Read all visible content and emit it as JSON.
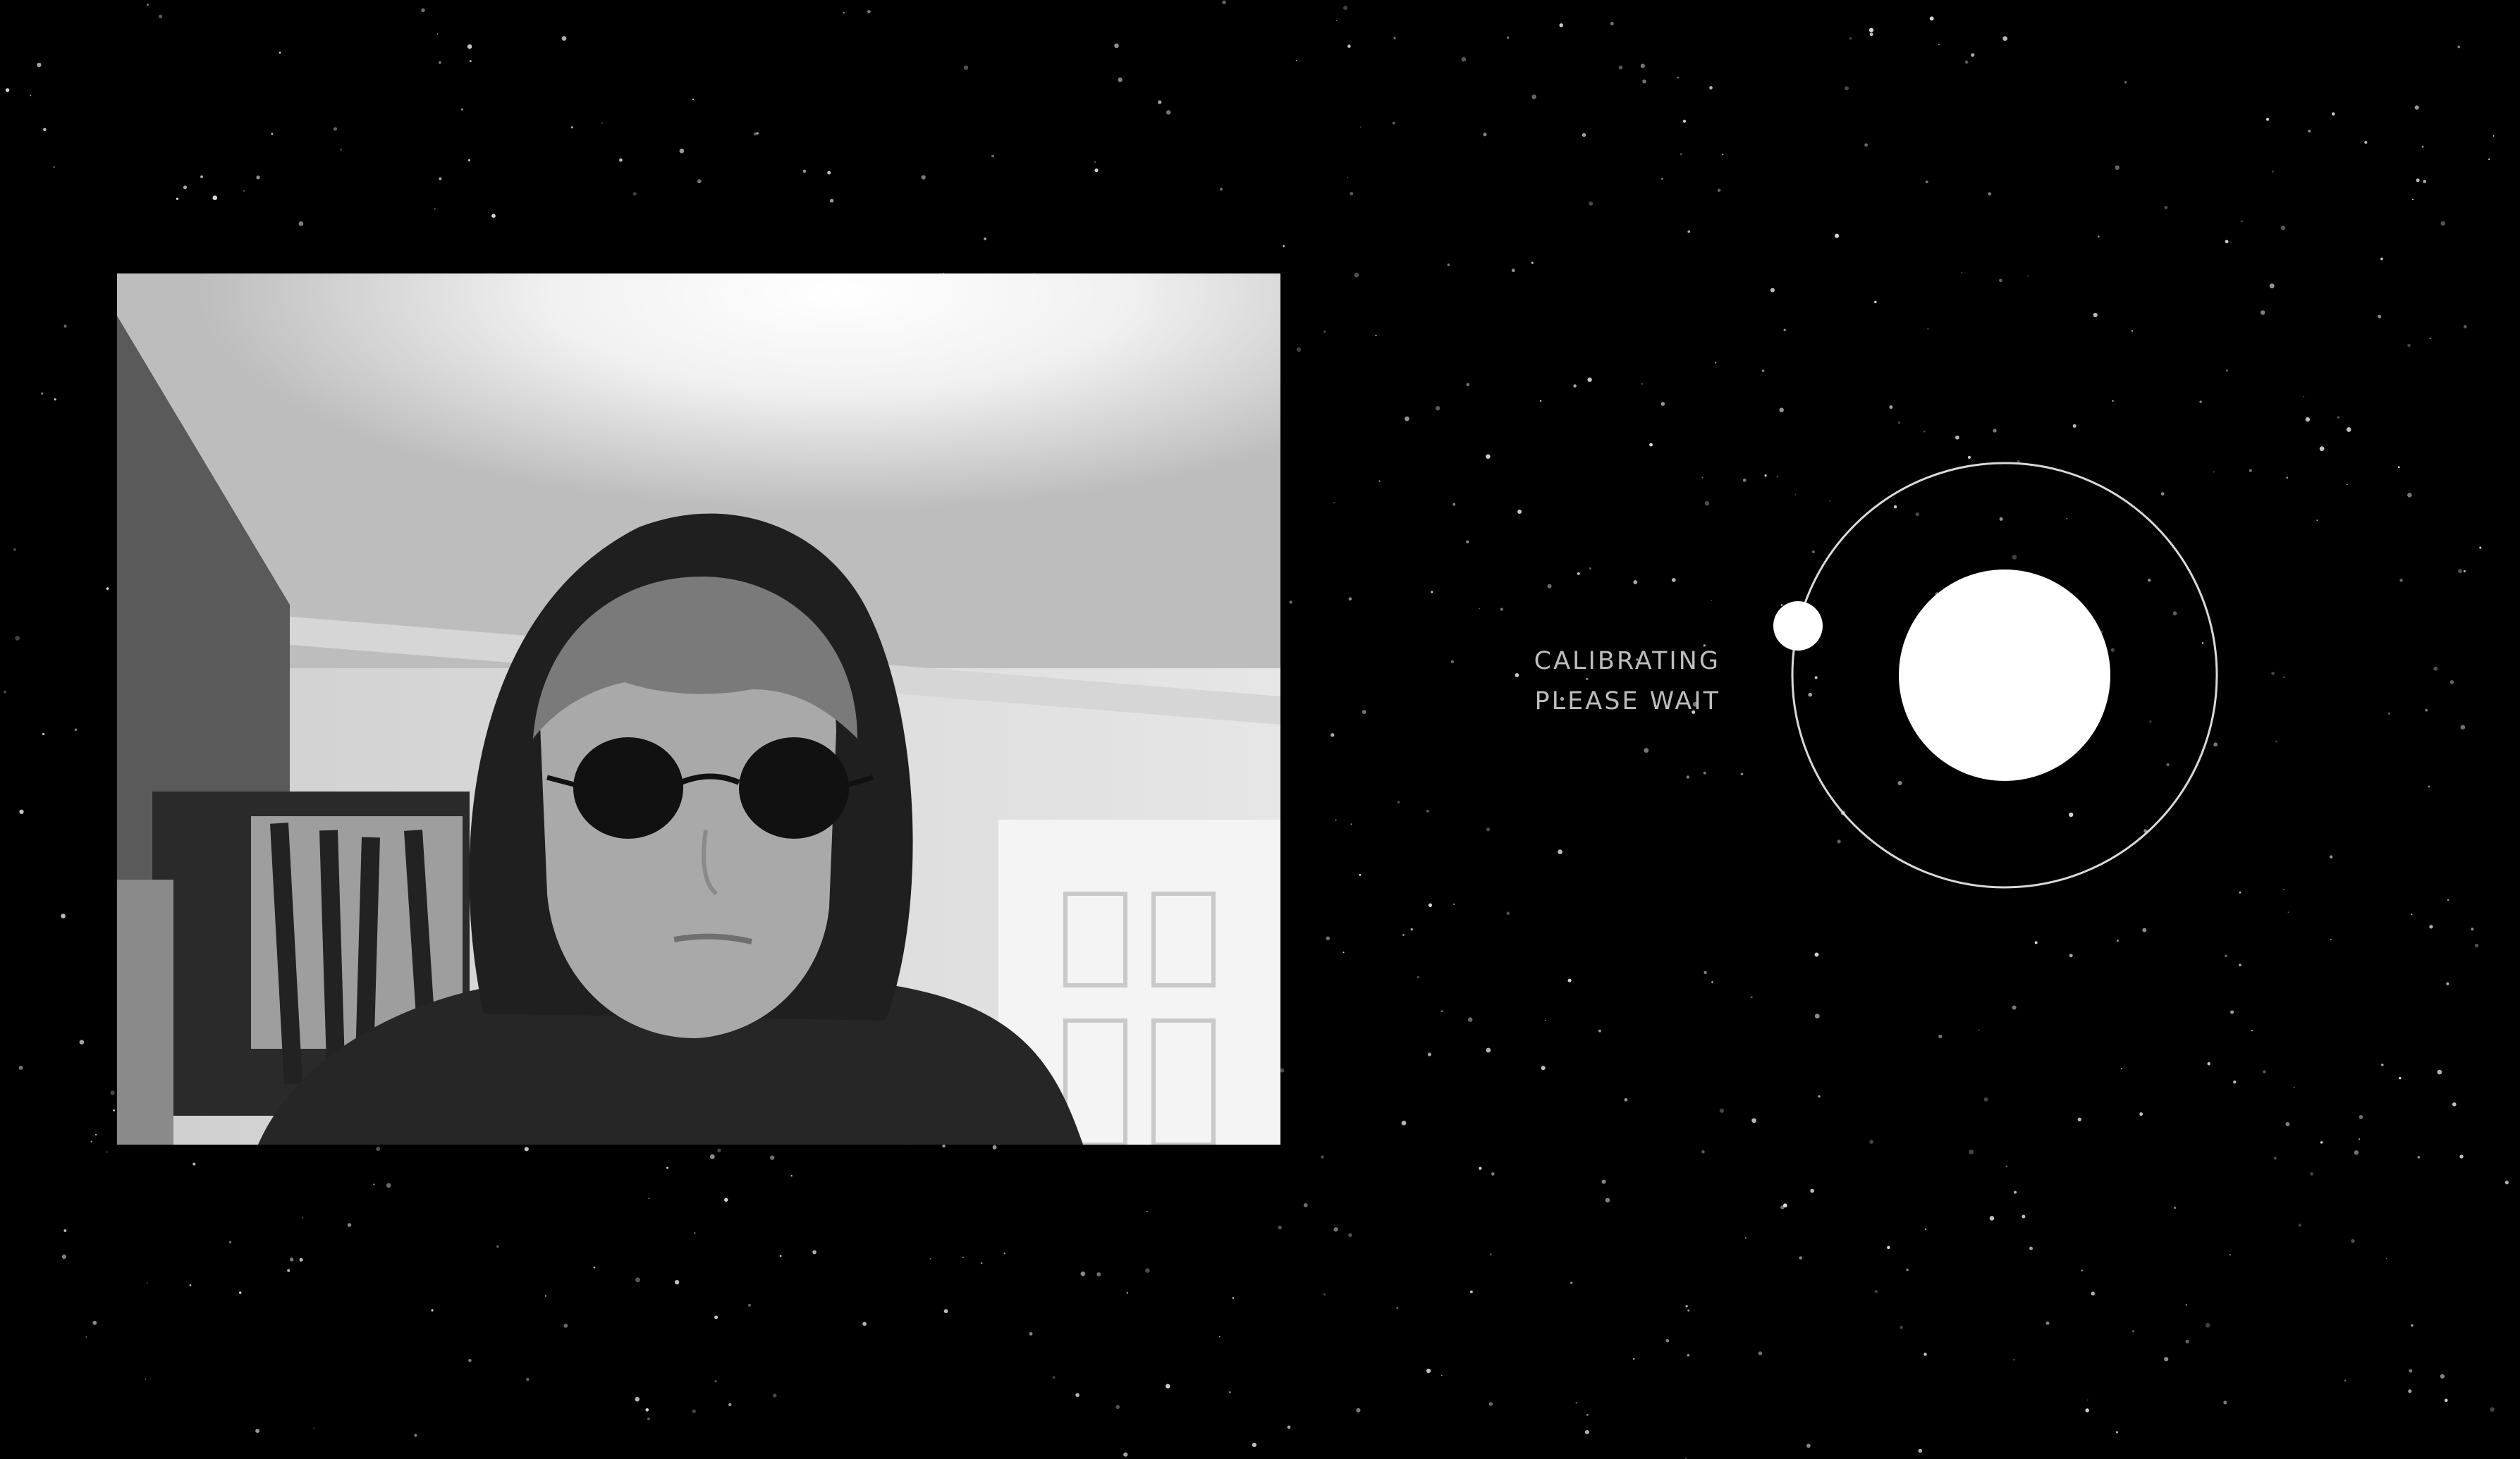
{
  "calibration": {
    "status_line_1": "CALIBRATING",
    "status_line_2": "PLEASE WAIT"
  },
  "colors": {
    "background": "#000000",
    "stars": "#ffffff",
    "status_text": "#bdbdbd",
    "planet": "#ffffff",
    "orbit_ring": "#d9d9d9"
  },
  "icons": {
    "calibration_indicator": "orbit-icon",
    "webcam": "camera-feed"
  }
}
